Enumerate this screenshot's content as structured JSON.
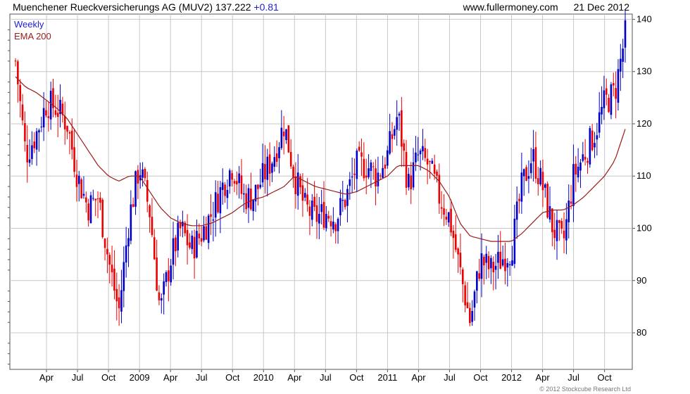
{
  "header": {
    "title": "Muenchener Rueckversicherungs AG (MUV2)",
    "price": "137.222",
    "change": "+0.81",
    "source": "www.fullermoney.com",
    "date": "21 Dec 2012"
  },
  "legend": {
    "weekly": "Weekly",
    "ema": "EMA 200"
  },
  "copyright": "© 2012 Stockcube Research Ltd",
  "colors": {
    "up": "#0000cc",
    "down": "#ee0000",
    "ema": "#9b1b1b",
    "grid": "#c8c8c8"
  },
  "chart_data": {
    "type": "line",
    "title": "Muenchener Rueckversicherungs AG (MUV2) 137.222 +0.81",
    "ylim": [
      73,
      141
    ],
    "yticks": [
      80,
      90,
      100,
      110,
      120,
      130,
      140
    ],
    "x_tick_labels": [
      "Apr",
      "Jul",
      "Oct",
      "2009",
      "Apr",
      "Jul",
      "Oct",
      "2010",
      "Apr",
      "Jul",
      "Oct",
      "2011",
      "Apr",
      "Jul",
      "Oct",
      "2012",
      "Apr",
      "Jul",
      "Oct"
    ],
    "x_start": "2008-01-04",
    "grid": true,
    "legend_position": "top-left",
    "series": [
      {
        "name": "Weekly",
        "x": [
          "2008-01",
          "2008-02",
          "2008-03",
          "2008-04",
          "2008-05",
          "2008-06",
          "2008-07",
          "2008-08",
          "2008-09",
          "2008-10",
          "2008-11",
          "2008-12",
          "2009-01",
          "2009-02",
          "2009-03",
          "2009-04",
          "2009-05",
          "2009-06",
          "2009-07",
          "2009-08",
          "2009-09",
          "2009-10",
          "2009-11",
          "2009-12",
          "2010-01",
          "2010-02",
          "2010-03",
          "2010-04",
          "2010-05",
          "2010-06",
          "2010-07",
          "2010-08",
          "2010-09",
          "2010-10",
          "2010-11",
          "2010-12",
          "2011-01",
          "2011-02",
          "2011-03",
          "2011-04",
          "2011-05",
          "2011-06",
          "2011-07",
          "2011-08",
          "2011-09",
          "2011-10",
          "2011-11",
          "2011-12",
          "2012-01",
          "2012-02",
          "2012-03",
          "2012-04",
          "2012-05",
          "2012-06",
          "2012-07",
          "2012-08",
          "2012-09",
          "2012-10",
          "2012-11",
          "2012-12"
        ],
        "values": [
          132,
          114,
          118,
          124,
          123,
          120,
          110,
          104,
          106,
          94,
          84,
          102,
          112,
          103,
          84,
          94,
          100,
          96,
          99,
          103,
          108,
          112,
          106,
          106,
          110,
          114,
          120,
          110,
          104,
          102,
          103,
          102,
          106,
          112,
          112,
          110,
          114,
          122,
          108,
          114,
          112,
          106,
          102,
          92,
          82,
          94,
          92,
          94,
          96,
          108,
          114,
          108,
          100,
          97,
          110,
          114,
          118,
          124,
          126,
          137
        ]
      },
      {
        "name": "EMA 200",
        "x": [
          "2008-01",
          "2008-02",
          "2008-03",
          "2008-04",
          "2008-05",
          "2008-06",
          "2008-07",
          "2008-08",
          "2008-09",
          "2008-10",
          "2008-11",
          "2008-12",
          "2009-01",
          "2009-02",
          "2009-03",
          "2009-04",
          "2009-05",
          "2009-06",
          "2009-07",
          "2009-08",
          "2009-09",
          "2009-10",
          "2009-11",
          "2009-12",
          "2010-01",
          "2010-02",
          "2010-03",
          "2010-04",
          "2010-05",
          "2010-06",
          "2010-07",
          "2010-08",
          "2010-09",
          "2010-10",
          "2010-11",
          "2010-12",
          "2011-01",
          "2011-02",
          "2011-03",
          "2011-04",
          "2011-05",
          "2011-06",
          "2011-07",
          "2011-08",
          "2011-09",
          "2011-10",
          "2011-11",
          "2011-12",
          "2012-01",
          "2012-02",
          "2012-03",
          "2012-04",
          "2012-05",
          "2012-06",
          "2012-07",
          "2012-08",
          "2012-09",
          "2012-10",
          "2012-11",
          "2012-12"
        ],
        "values": [
          129,
          127,
          126,
          124.5,
          123,
          121,
          118,
          115,
          112,
          110,
          109,
          110,
          110,
          107,
          104,
          102,
          101,
          100.5,
          100.5,
          101,
          102,
          103,
          104.5,
          105.5,
          106,
          107,
          108,
          110,
          109,
          108,
          107.5,
          107,
          106.5,
          107,
          108,
          109,
          110,
          112,
          112,
          112,
          111,
          109,
          106,
          101,
          98.5,
          98,
          97.5,
          97.5,
          97.5,
          99,
          101,
          103,
          103.5,
          103.5,
          104.5,
          106,
          108,
          110,
          113,
          119
        ]
      }
    ]
  }
}
